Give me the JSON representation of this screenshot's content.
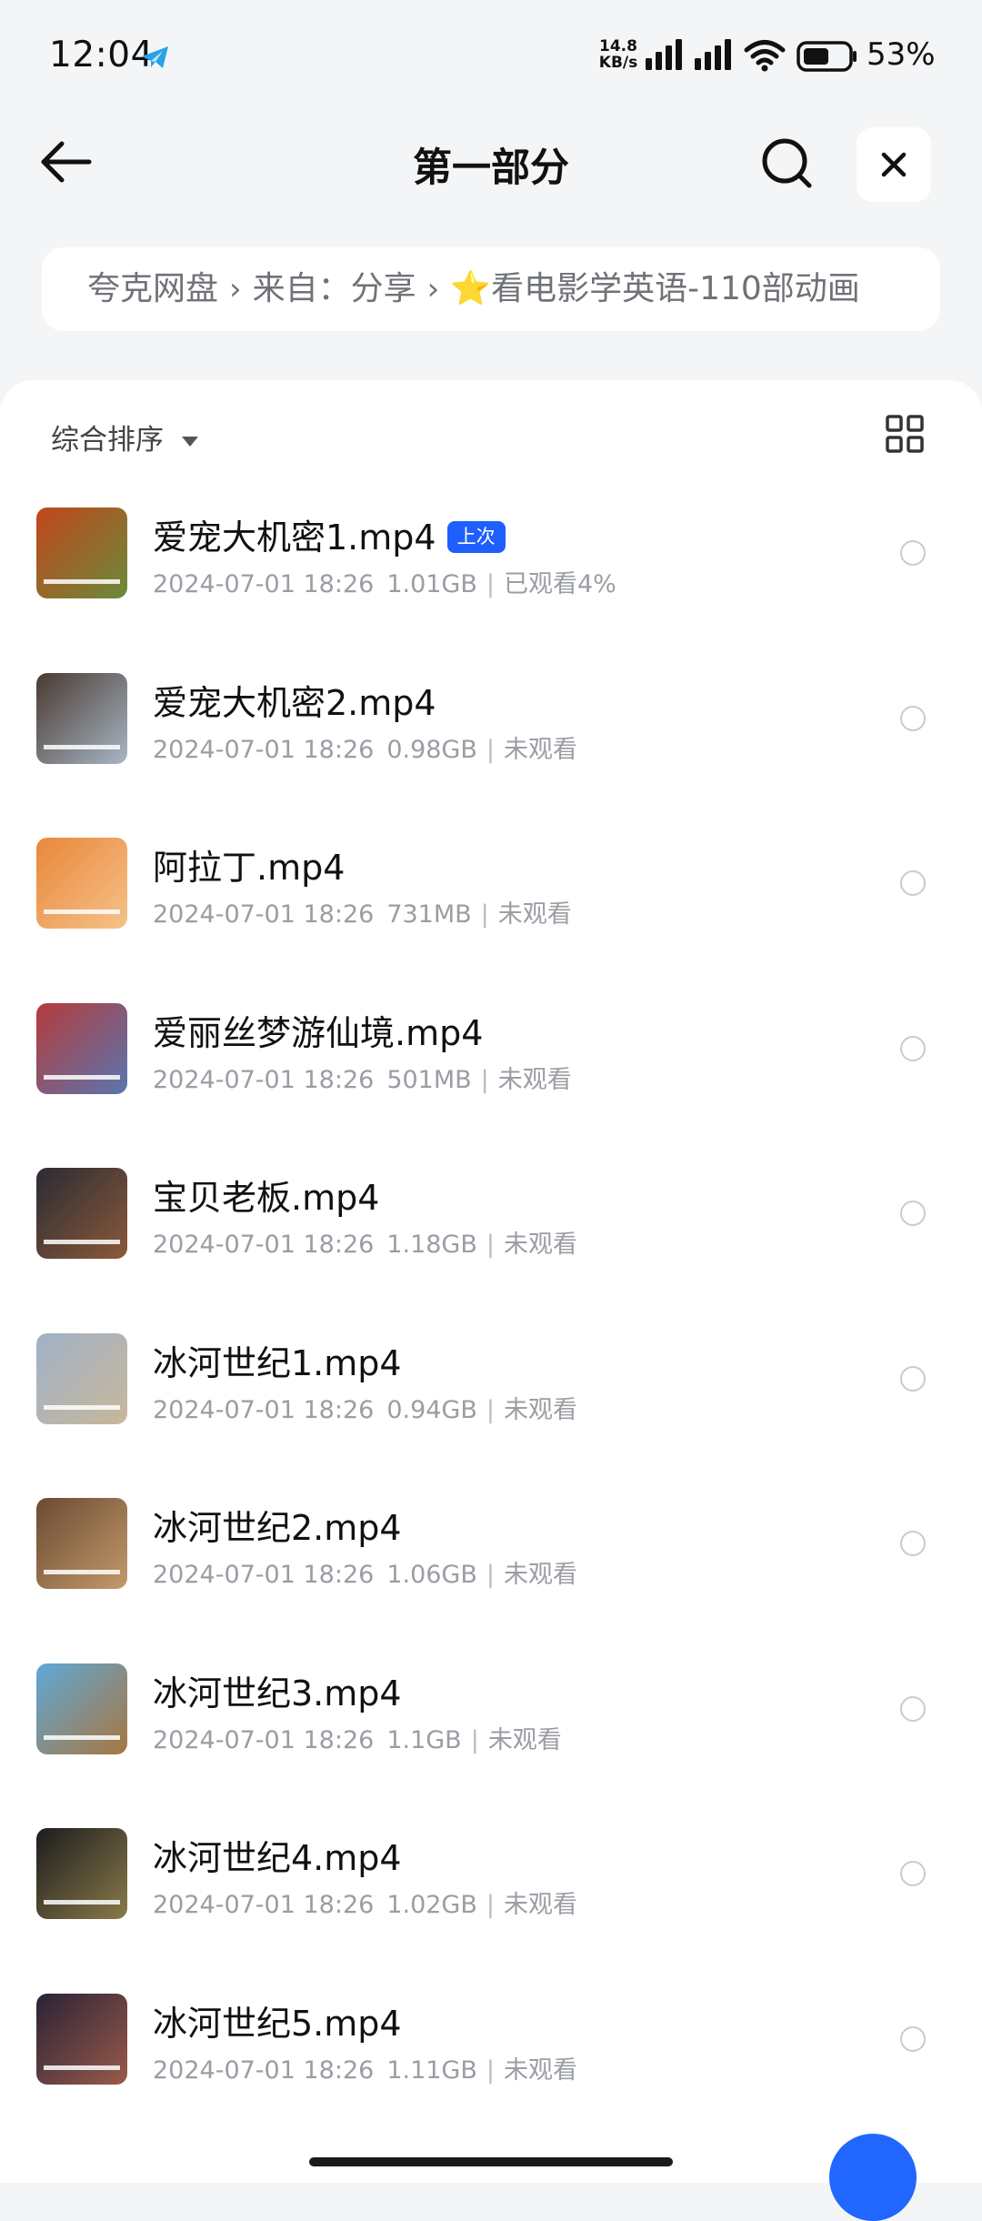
{
  "status_bar": {
    "time": "12:04",
    "net_speed_value": "14.8",
    "net_speed_unit": "KB/s",
    "battery": "53%",
    "icons": [
      "telegram-icon",
      "signal-icon",
      "signal-icon",
      "wifi-icon",
      "battery-icon"
    ]
  },
  "header": {
    "title": "第一部分",
    "icons": [
      "back-arrow-icon",
      "search-icon",
      "close-icon"
    ]
  },
  "breadcrumb": {
    "items": [
      "夸克网盘",
      "来自：分享",
      "⭐看电影学英语-110部动画"
    ],
    "separator": "›"
  },
  "toolbar": {
    "sort_label": "综合排序",
    "icons": [
      "dropdown-arrow-icon",
      "grid-view-icon"
    ]
  },
  "files": [
    {
      "name": "爱宠大机密1.mp4",
      "badge": "上次",
      "date": "2024-07-01 18:26",
      "size": "1.01GB",
      "status": "已观看4%",
      "thumb_colors": [
        "#c2461c",
        "#6a8a3a"
      ]
    },
    {
      "name": "爱宠大机密2.mp4",
      "badge": "",
      "date": "2024-07-01 18:26",
      "size": "0.98GB",
      "status": "未观看",
      "thumb_colors": [
        "#4a3a32",
        "#a7b6c4"
      ]
    },
    {
      "name": "阿拉丁.mp4",
      "badge": "",
      "date": "2024-07-01 18:26",
      "size": "731MB",
      "status": "未观看",
      "thumb_colors": [
        "#e8873a",
        "#f6c28a"
      ]
    },
    {
      "name": "爱丽丝梦游仙境.mp4",
      "badge": "",
      "date": "2024-07-01 18:26",
      "size": "501MB",
      "status": "未观看",
      "thumb_colors": [
        "#b43b3b",
        "#5a76b0"
      ]
    },
    {
      "name": "宝贝老板.mp4",
      "badge": "",
      "date": "2024-07-01 18:26",
      "size": "1.18GB",
      "status": "未观看",
      "thumb_colors": [
        "#2b2b33",
        "#8a5a3a"
      ]
    },
    {
      "name": "冰河世纪1.mp4",
      "badge": "",
      "date": "2024-07-01 18:26",
      "size": "0.94GB",
      "status": "未观看",
      "thumb_colors": [
        "#9fb2c8",
        "#c8b79a"
      ]
    },
    {
      "name": "冰河世纪2.mp4",
      "badge": "",
      "date": "2024-07-01 18:26",
      "size": "1.06GB",
      "status": "未观看",
      "thumb_colors": [
        "#6a4a34",
        "#c49a6a"
      ]
    },
    {
      "name": "冰河世纪3.mp4",
      "badge": "",
      "date": "2024-07-01 18:26",
      "size": "1.1GB",
      "status": "未观看",
      "thumb_colors": [
        "#5fa8d8",
        "#a8763e"
      ]
    },
    {
      "name": "冰河世纪4.mp4",
      "badge": "",
      "date": "2024-07-01 18:26",
      "size": "1.02GB",
      "status": "未观看",
      "thumb_colors": [
        "#1c1c1c",
        "#8a7a4a"
      ]
    },
    {
      "name": "冰河世纪5.mp4",
      "badge": "",
      "date": "2024-07-01 18:26",
      "size": "1.11GB",
      "status": "未观看",
      "thumb_colors": [
        "#2a2236",
        "#9a5a4a"
      ]
    }
  ],
  "colors": {
    "accent": "#1f5fff",
    "page_background": "#f4f5f7",
    "card_background": "#ffffff",
    "meta_text": "#9a9da3"
  }
}
